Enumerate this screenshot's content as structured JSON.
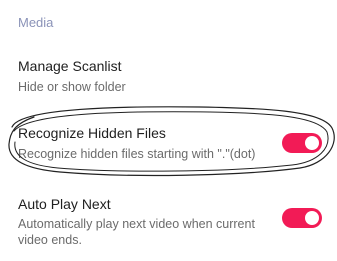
{
  "section": {
    "title": "Media"
  },
  "settings": [
    {
      "title": "Manage Scanlist",
      "description": "Hide or show folder"
    },
    {
      "title": "Recognize Hidden Files",
      "description": "Recognize hidden files starting with \".\"(dot)",
      "enabled": true
    },
    {
      "title": "Auto Play Next",
      "description_line1": "Automatically play next video when current",
      "description_line2": "video ends.",
      "enabled": true
    }
  ],
  "colors": {
    "accent": "#f21b56",
    "section_header": "#8b93b8"
  }
}
